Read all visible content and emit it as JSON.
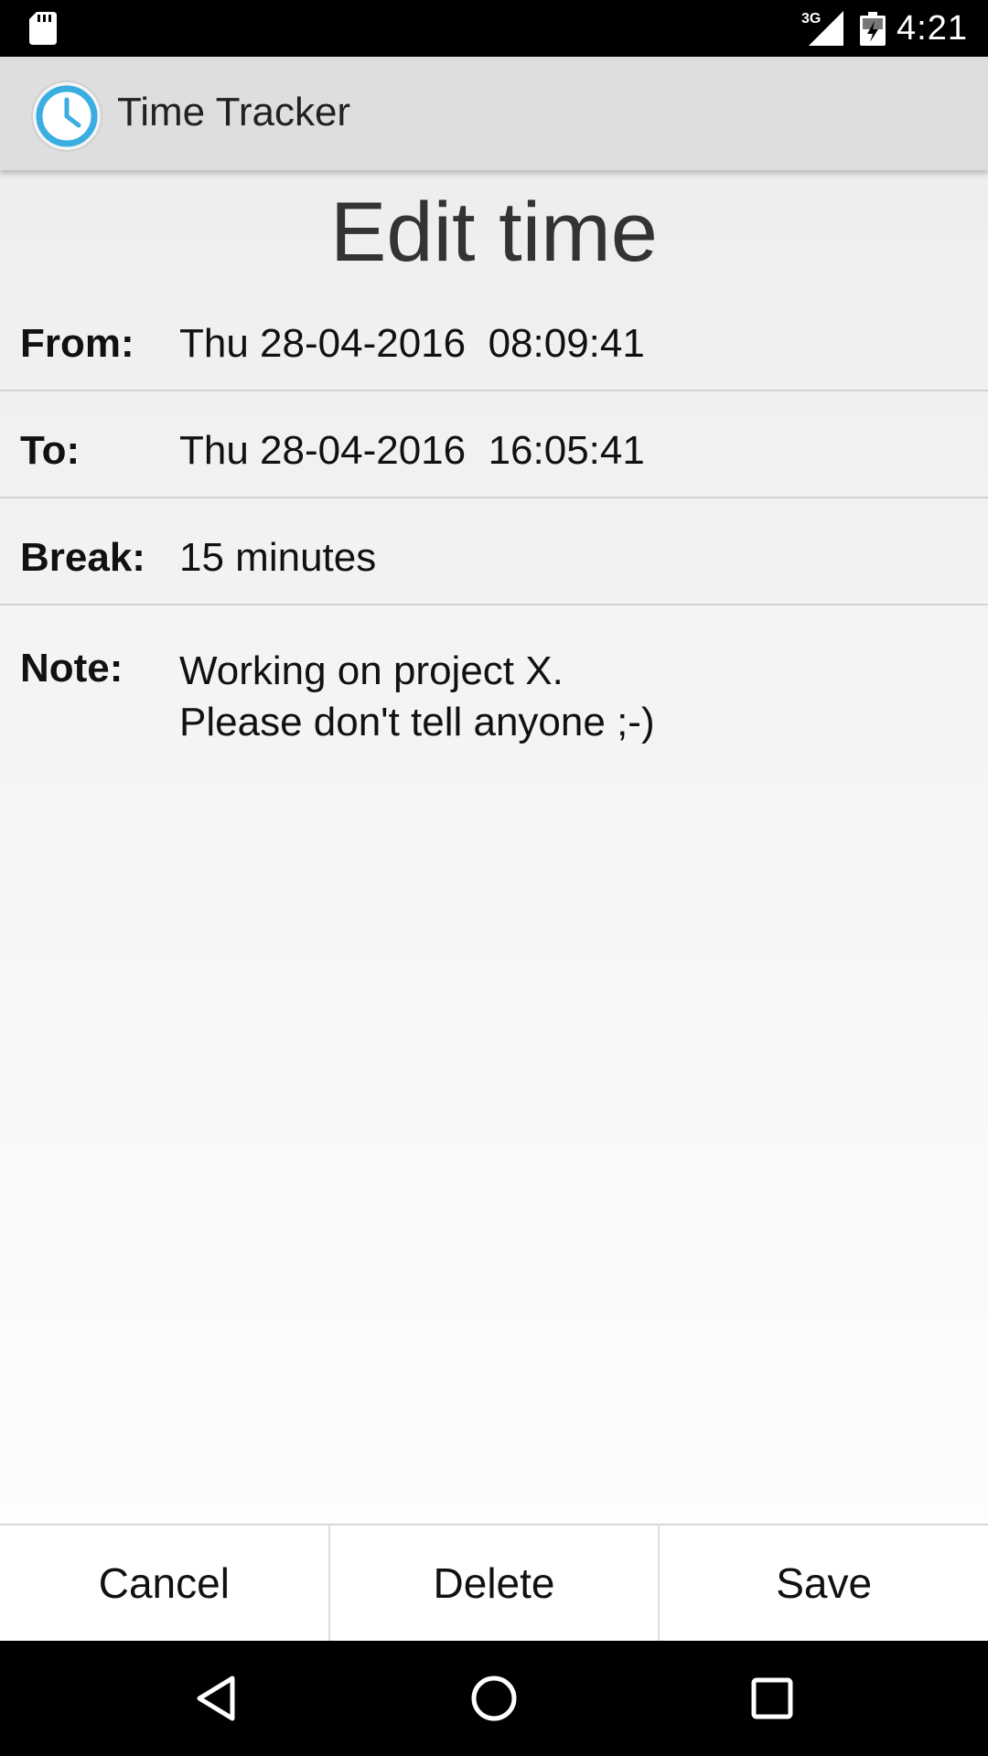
{
  "status_bar": {
    "time": "4:21",
    "network": "3G",
    "icons": [
      "sd-card-icon",
      "signal-icon",
      "battery-icon"
    ]
  },
  "app_bar": {
    "title": "Time Tracker",
    "logo_icon": "clock-icon",
    "accent_color": "#3aaee0"
  },
  "page": {
    "title": "Edit time"
  },
  "fields": {
    "from": {
      "label": "From:",
      "value": "Thu 28-04-2016  08:09:41"
    },
    "to": {
      "label": "To:",
      "value": "Thu 28-04-2016  16:05:41"
    },
    "break": {
      "label": "Break:",
      "value": "15 minutes"
    },
    "note": {
      "label": "Note:",
      "line1": "Working on project X.",
      "line2": "Please don't tell anyone ;-)"
    }
  },
  "buttons": {
    "cancel": "Cancel",
    "delete": "Delete",
    "save": "Save"
  },
  "nav": {
    "icons": [
      "back-icon",
      "home-icon",
      "recents-icon"
    ]
  }
}
